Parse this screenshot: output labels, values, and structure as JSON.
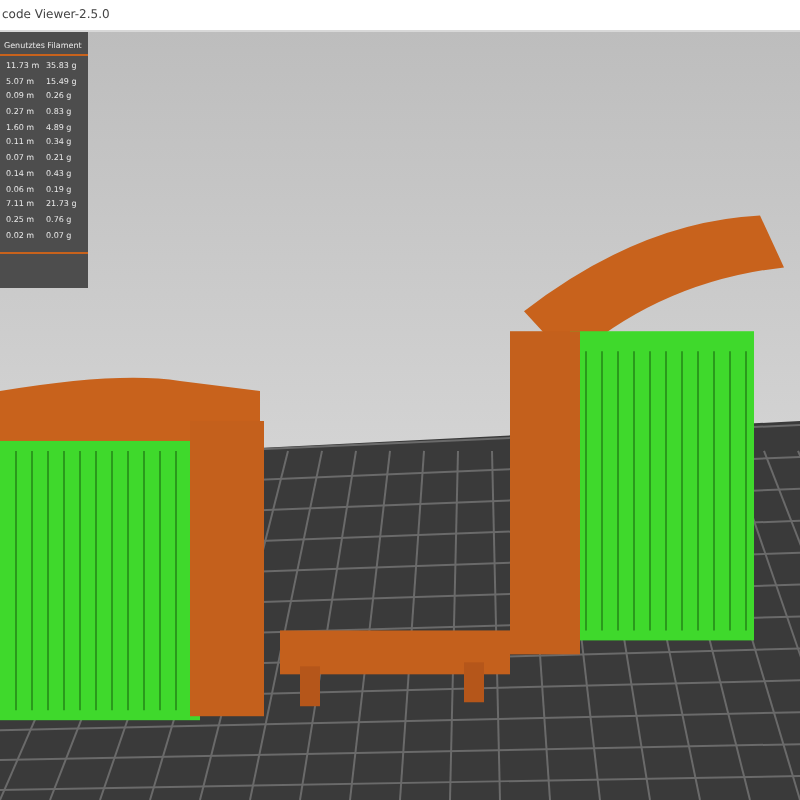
{
  "window": {
    "title": "code Viewer-2.5.0"
  },
  "legend": {
    "header": "Genutztes Filament",
    "rows": [
      {
        "length": "11.73 m",
        "weight": "35.83 g"
      },
      {
        "length": "5.07 m",
        "weight": "15.49 g"
      },
      {
        "length": "0.09 m",
        "weight": "0.26 g"
      },
      {
        "length": "0.27 m",
        "weight": "0.83 g"
      },
      {
        "length": "1.60 m",
        "weight": "4.89 g"
      },
      {
        "length": "0.11 m",
        "weight": "0.34 g"
      },
      {
        "length": "0.07 m",
        "weight": "0.21 g"
      },
      {
        "length": "0.14 m",
        "weight": "0.43 g"
      },
      {
        "length": "0.06 m",
        "weight": "0.19 g"
      },
      {
        "length": "7.11 m",
        "weight": "21.73 g"
      },
      {
        "length": "0.25 m",
        "weight": "0.76 g"
      },
      {
        "length": "0.02 m",
        "weight": "0.07 g"
      }
    ]
  }
}
